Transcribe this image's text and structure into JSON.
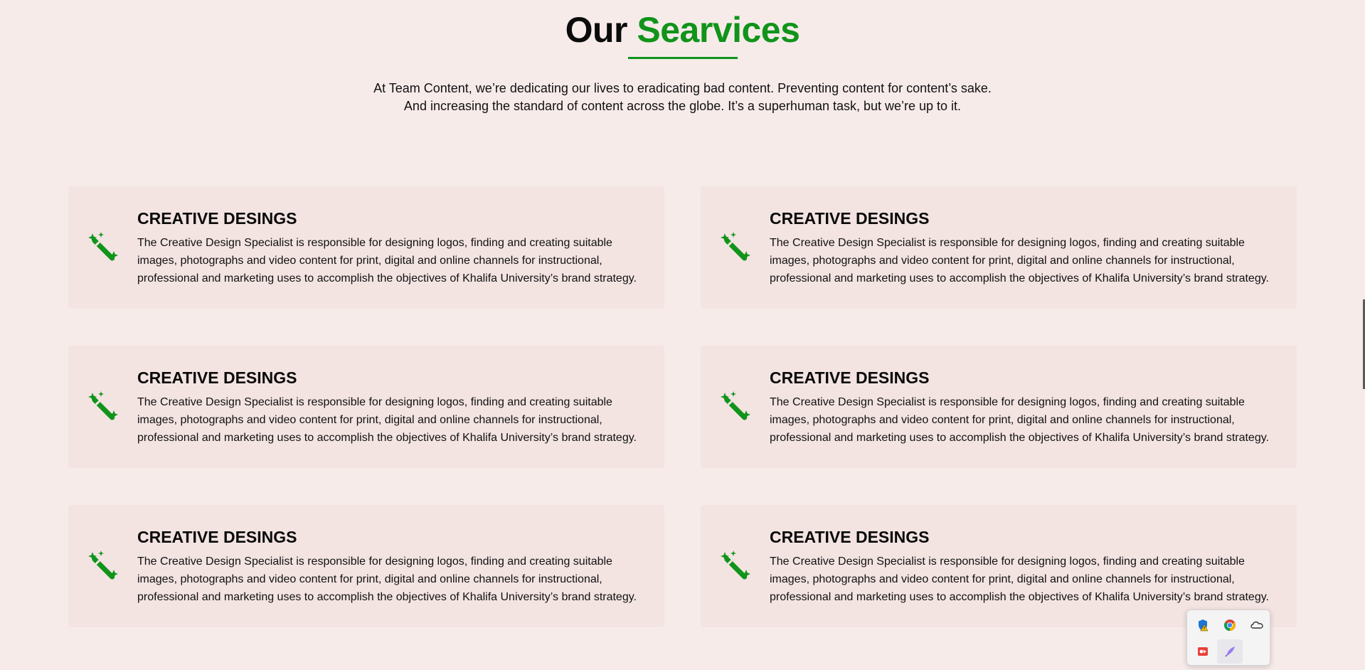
{
  "heading": {
    "word1": "Our",
    "word2": "Searvices"
  },
  "intro": {
    "line1": "At Team Content, we’re dedicating our lives to eradicating bad content. Preventing content for content’s sake.",
    "line2": "And increasing the standard of content across the globe. It’s a superhuman task, but we’re up to it."
  },
  "colors": {
    "accent": "#10941a",
    "background": "#f7ebea",
    "card": "#f3e4e2"
  },
  "cards": [
    {
      "icon": "magic-wand-sparkles-icon",
      "title": "CREATIVE DESINGS",
      "text": "The Creative Design Specialist is responsible for designing logos, finding and creating suitable images, photographs and video content for print, digital and online channels for instructional, professional and marketing uses to accomplish the objectives of Khalifa University’s brand strategy."
    },
    {
      "icon": "magic-wand-sparkles-icon",
      "title": "CREATIVE DESINGS",
      "text": "The Creative Design Specialist is responsible for designing logos, finding and creating suitable images, photographs and video content for print, digital and online channels for instructional, professional and marketing uses to accomplish the objectives of Khalifa University’s brand strategy."
    },
    {
      "icon": "magic-wand-sparkles-icon",
      "title": "CREATIVE DESINGS",
      "text": "The Creative Design Specialist is responsible for designing logos, finding and creating suitable images, photographs and video content for print, digital and online channels for instructional, professional and marketing uses to accomplish the objectives of Khalifa University’s brand strategy."
    },
    {
      "icon": "magic-wand-sparkles-icon",
      "title": "CREATIVE DESINGS",
      "text": "The Creative Design Specialist is responsible for designing logos, finding and creating suitable images, photographs and video content for print, digital and online channels for instructional, professional and marketing uses to accomplish the objectives of Khalifa University’s brand strategy."
    },
    {
      "icon": "magic-wand-sparkles-icon",
      "title": "CREATIVE DESINGS",
      "text": "The Creative Design Specialist is responsible for designing logos, finding and creating suitable images, photographs and video content for print, digital and online channels for instructional, professional and marketing uses to accomplish the objectives of Khalifa University’s brand strategy."
    },
    {
      "icon": "magic-wand-sparkles-icon",
      "title": "CREATIVE DESINGS",
      "text": "The Creative Design Specialist is responsible for designing logos, finding and creating suitable images, photographs and video content for print, digital and online channels for instructional, professional and marketing uses to accomplish the objectives of Khalifa University’s brand strategy."
    }
  ],
  "tray": {
    "icons": [
      "security-warning-icon",
      "chrome-icon",
      "cloud-icon",
      "record-icon",
      "feather-pen-icon"
    ]
  }
}
